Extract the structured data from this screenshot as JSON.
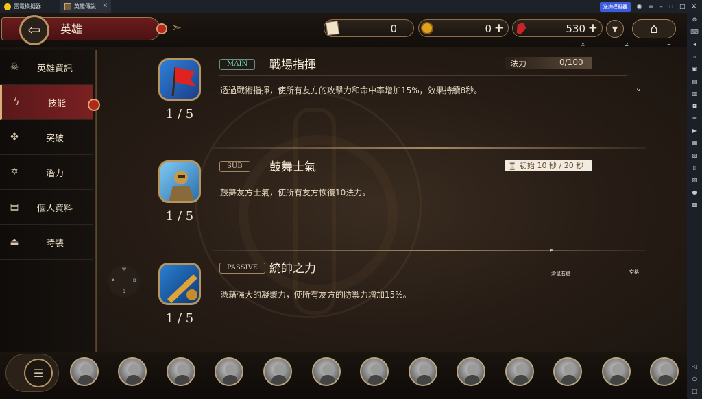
{
  "emulator": {
    "app_name": "雷電模擬器",
    "tab_title": "英雄傳說",
    "sync_label": "送詢模擬器"
  },
  "header": {
    "title": "英雄",
    "resources": [
      {
        "icon": "scroll-ticket-icon",
        "value": "0"
      },
      {
        "icon": "gold-coin-icon",
        "value": "0"
      },
      {
        "icon": "red-crystal-icon",
        "value": "530"
      }
    ],
    "key_hints": {
      "x": "X",
      "z": "Z",
      "tilde": "~",
      "g": "G",
      "e": "E",
      "space_hint_left": "滑鼠右鍵",
      "space_hint_right": "空格"
    }
  },
  "nav": {
    "items": [
      {
        "label": "英雄資訊",
        "icon": "skull-icon"
      },
      {
        "label": "技能",
        "icon": "lightning-icon"
      },
      {
        "label": "突破",
        "icon": "clover-icon"
      },
      {
        "label": "潛力",
        "icon": "star-of-david-icon"
      },
      {
        "label": "個人資料",
        "icon": "document-icon"
      },
      {
        "label": "時裝",
        "icon": "hanger-icon"
      }
    ],
    "active_index": 1
  },
  "dpad": {
    "up": "W",
    "left": "A",
    "right": "D",
    "down": "S"
  },
  "skills": [
    {
      "type": "MAIN",
      "name": "戰場指揮",
      "level": "1 / 5",
      "description": "透過戰術指揮，使所有友方的攻擊力和命中率增加15%，效果持續8秒。",
      "cost_label": "法力",
      "cost_value": "0/100"
    },
    {
      "type": "SUB",
      "name": "鼓舞士氣",
      "level": "1 / 5",
      "description": "鼓舞友方士氣，使所有友方恢復10法力。",
      "cooldown": "初始 10 秒 / 20 秒"
    },
    {
      "type": "PASSIVE",
      "name": "統帥之力",
      "level": "1 / 5",
      "description": "憑藉強大的凝聚力，使所有友方的防禦力增加15%。"
    }
  ],
  "colors": {
    "accent_red": "#7a2022",
    "gold_border": "#b69463",
    "main_tag": "#6fd3c6"
  }
}
